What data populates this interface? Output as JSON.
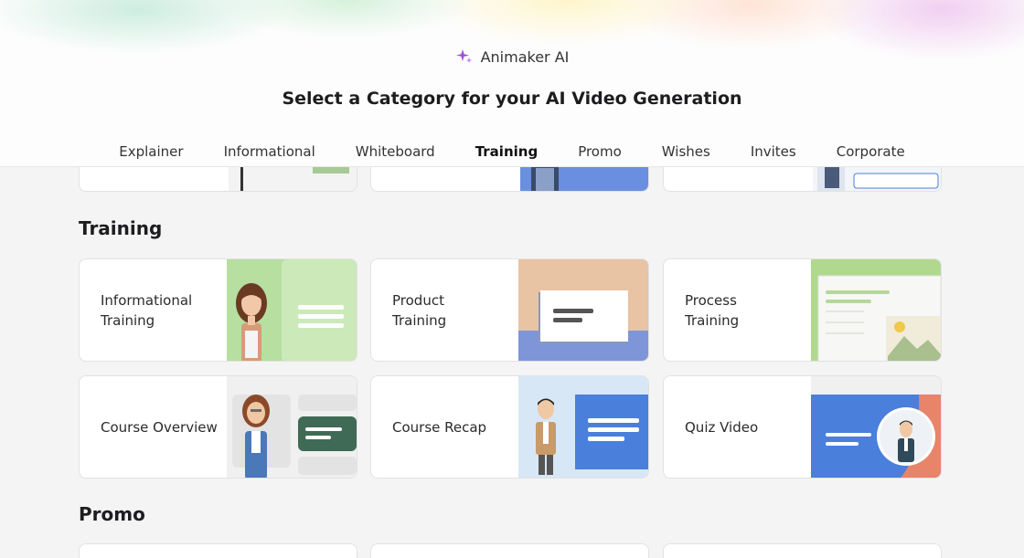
{
  "brand": {
    "name": "Animaker AI",
    "icon": "sparkle-icon"
  },
  "page_title": "Select a Category for your AI Video Generation",
  "tabs": [
    {
      "label": "Explainer"
    },
    {
      "label": "Informational"
    },
    {
      "label": "Whiteboard"
    },
    {
      "label": "Training",
      "active": true
    },
    {
      "label": "Promo"
    },
    {
      "label": "Wishes"
    },
    {
      "label": "Invites"
    },
    {
      "label": "Corporate"
    }
  ],
  "sections": {
    "training": {
      "title": "Training",
      "cards": [
        {
          "label": "Informational Training"
        },
        {
          "label": "Product Training"
        },
        {
          "label": "Process Training"
        },
        {
          "label": "Course Overview"
        },
        {
          "label": "Course Recap"
        },
        {
          "label": "Quiz Video"
        }
      ]
    },
    "promo": {
      "title": "Promo"
    }
  },
  "colors": {
    "accent_purple": "#a04ed8",
    "green_thumb": "#a9d98c",
    "blue_thumb": "#4a7fdc",
    "peach_thumb": "#e8b894",
    "dark_green": "#3f6a55",
    "coral": "#e8846a"
  }
}
